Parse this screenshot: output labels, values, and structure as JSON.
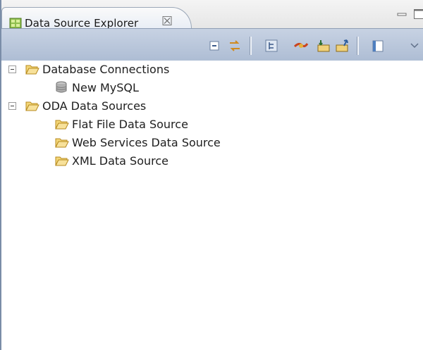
{
  "view": {
    "title": "Data Source Explorer",
    "close_glyph": "☒"
  },
  "toolbar": {
    "buttons": [
      {
        "name": "collapse-all-icon"
      },
      {
        "name": "link-with-editor-icon"
      },
      {
        "name": "tree-view-icon"
      },
      {
        "name": "connect-icon"
      },
      {
        "name": "import-icon"
      },
      {
        "name": "export-icon"
      },
      {
        "name": "view-menu-icon"
      }
    ]
  },
  "tree": {
    "items": [
      {
        "label": "Database Connections",
        "type": "folder",
        "expanded": true
      },
      {
        "label": "New MySQL",
        "type": "database"
      },
      {
        "label": "ODA Data Sources",
        "type": "folder",
        "expanded": true
      },
      {
        "label": "Flat File Data Source",
        "type": "folder"
      },
      {
        "label": "Web Services Data Source",
        "type": "folder"
      },
      {
        "label": "XML Data Source",
        "type": "folder"
      }
    ]
  },
  "colors": {
    "folder": "#e8c25a",
    "toolbar": "#bac8dc",
    "border": "#7a8da8"
  }
}
